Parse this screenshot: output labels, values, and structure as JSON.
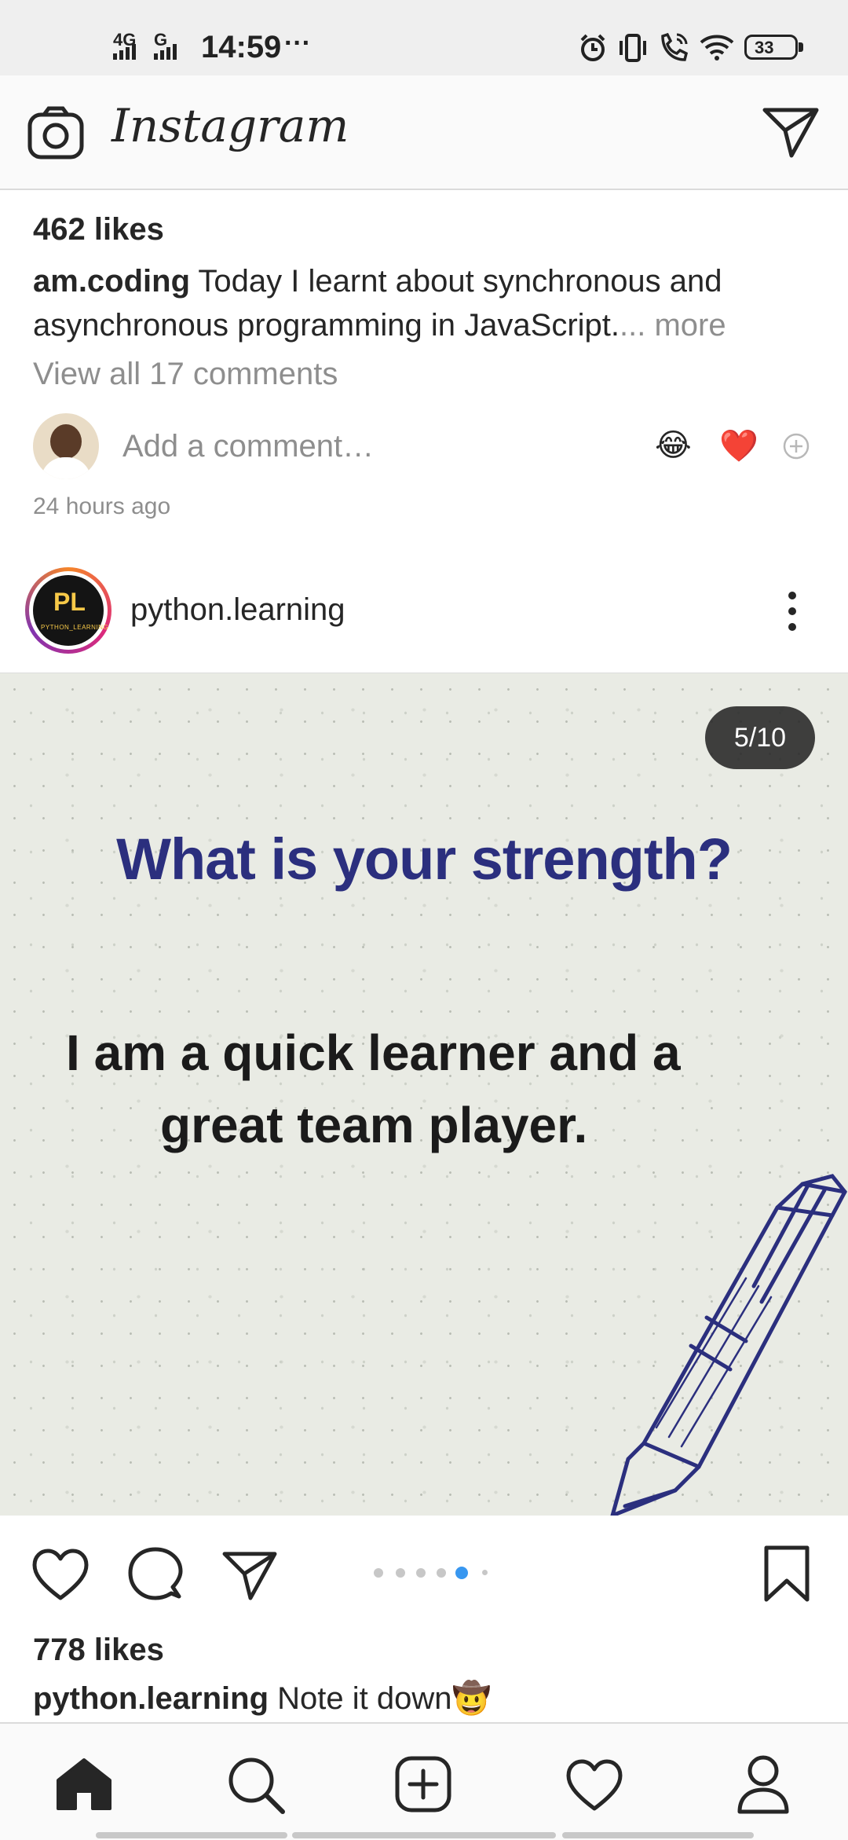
{
  "status_bar": {
    "network_1": "4G",
    "network_2": "G",
    "time": "14:59",
    "more": "···",
    "battery": "33"
  },
  "header": {
    "app_title": "Instagram"
  },
  "post_1": {
    "likes": "462 likes",
    "username": "am.coding",
    "caption": "Today I learnt about synchronous and asynchronous programming in JavaScript.",
    "more": "... more",
    "view_comments": "View all 17 comments",
    "add_comment_placeholder": "Add a comment…",
    "quick_emoji_1": "😂",
    "quick_emoji_2": "❤️",
    "time_ago": "24 hours ago"
  },
  "post_2": {
    "username": "python.learning",
    "avatar_initials": "PL",
    "avatar_caption": "PYTHON_LEARNING",
    "counter": "5/10",
    "image_heading": "What is your strength?",
    "image_text_line_1": "I am a quick learner and a",
    "image_text_line_2": "great team player.",
    "carousel_total": 6,
    "carousel_active": 5,
    "likes": "778 likes",
    "caption_username": "python.learning",
    "caption": "Note it down🤠"
  },
  "colors": {
    "heading_blue": "#2b2f7e",
    "carousel_active": "#3897f0"
  },
  "icons": {
    "camera": "camera-icon",
    "direct": "paper-plane-icon",
    "like": "heart-icon",
    "comment": "speech-bubble-icon",
    "share": "paper-plane-icon",
    "save": "bookmark-icon",
    "home": "home-icon",
    "search": "search-icon",
    "new_post": "plus-square-icon",
    "activity": "heart-icon",
    "profile": "person-icon"
  }
}
